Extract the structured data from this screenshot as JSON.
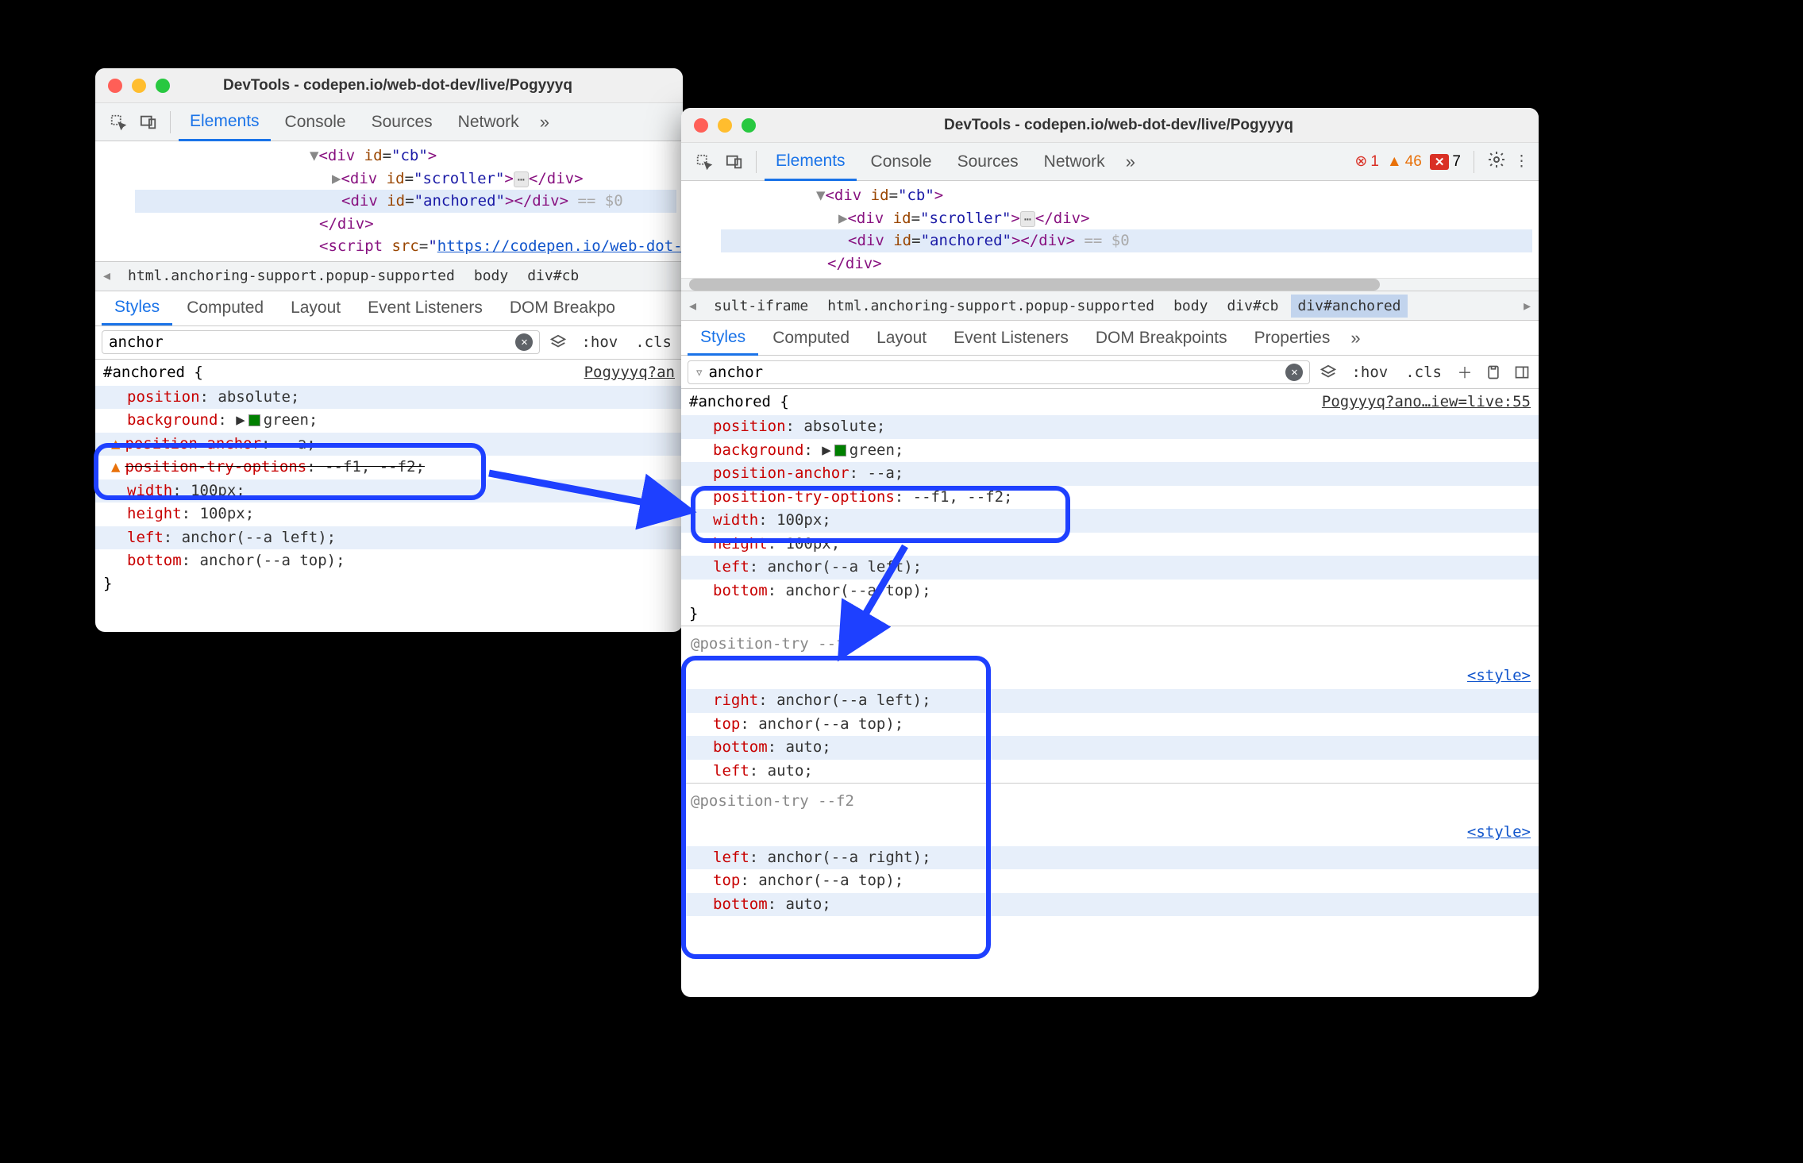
{
  "window_title": "DevTools - codepen.io/web-dot-dev/live/Pogyyyq",
  "tabs": {
    "elements": "Elements",
    "console": "Console",
    "sources": "Sources",
    "network": "Network"
  },
  "status": {
    "errors": "1",
    "warnings": "46",
    "violations": "7"
  },
  "dom": {
    "cb_open": "<div id=\"cb\">",
    "scroller": {
      "open": "<div id=\"scroller\">",
      "close": "</div>"
    },
    "anchored": {
      "open": "<div id=\"anchored\">",
      "close": "</div>",
      "eq": "== $0"
    },
    "div_close": "</div>",
    "script_line": "<script src=\"https://codepen.io/web-dot-d"
  },
  "breadcrumbs": {
    "left": [
      "html.anchoring-support.popup-supported",
      "body",
      "div#cb"
    ],
    "right": [
      "sult-iframe",
      "html.anchoring-support.popup-supported",
      "body",
      "div#cb",
      "div#anchored"
    ]
  },
  "subtabs": {
    "styles": "Styles",
    "computed": "Computed",
    "layout": "Layout",
    "event": "Event Listeners",
    "dom": "DOM Breakpoints",
    "properties": "Properties"
  },
  "filter": {
    "value": "anchor",
    "hov": ":hov",
    "cls": ".cls"
  },
  "rule_src_left": "Pogyyyq?an",
  "rule_src_right": "Pogyyyq?ano…iew=live:55",
  "selector": "#anchored {",
  "close_brace": "}",
  "props": {
    "position": {
      "n": "position",
      "v": ": absolute;"
    },
    "background": {
      "n": "background",
      "v_pre": ": ",
      "v_post": "green;"
    },
    "pos_anchor": {
      "n": "position-anchor",
      "v": ": --a;"
    },
    "pos_try": {
      "n": "position-try-options",
      "v": ": --f1, --f2;"
    },
    "width": {
      "n": "width",
      "v": ": 100px;"
    },
    "height": {
      "n": "height",
      "v": ": 100px;"
    },
    "left": {
      "n": "left",
      "v": ": anchor(--a left);"
    },
    "bottom": {
      "n": "bottom",
      "v": ": anchor(--a top);"
    }
  },
  "style_label": "<style>",
  "pos_try_f1": "@position-try --f1",
  "pos_try_f2": "@position-try --f2",
  "f1": {
    "right": {
      "n": "right",
      "v": ": anchor(--a left);"
    },
    "top": {
      "n": "top",
      "v": ": anchor(--a top);"
    },
    "bottom": {
      "n": "bottom",
      "v": ": auto;"
    },
    "left": {
      "n": "left",
      "v": ": auto;"
    }
  },
  "f2": {
    "left": {
      "n": "left",
      "v": ": anchor(--a right);"
    },
    "top": {
      "n": "top",
      "v": ": anchor(--a top);"
    },
    "bottom": {
      "n": "bottom",
      "v": ": auto;"
    }
  }
}
